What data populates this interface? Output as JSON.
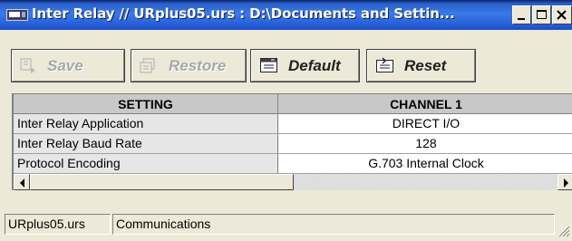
{
  "window": {
    "title": "Inter Relay // URplus05.urs : D:\\Documents and Settin...",
    "icon": "device-icon",
    "controls": {
      "minimize": "minimize-icon",
      "maximize": "maximize-icon",
      "close": "close-icon"
    }
  },
  "toolbar": {
    "save_label": "Save",
    "restore_label": "Restore",
    "default_label": "Default",
    "reset_label": "Reset",
    "save_enabled": false,
    "restore_enabled": false
  },
  "grid": {
    "columns": [
      "SETTING",
      "CHANNEL 1"
    ],
    "rows": [
      {
        "setting": "Inter Relay Application",
        "value": "DIRECT I/O"
      },
      {
        "setting": "Inter Relay Baud Rate",
        "value": "128"
      },
      {
        "setting": "Protocol Encoding",
        "value": "G.703 Internal Clock"
      }
    ]
  },
  "status": {
    "file": "URplus05.urs",
    "section": "Communications"
  },
  "colors": {
    "titlebar": "#2a5fc8",
    "window_bg": "#ece9d8",
    "header_bg": "#c8c8c8",
    "setting_cell_bg": "#e6e6e6"
  }
}
